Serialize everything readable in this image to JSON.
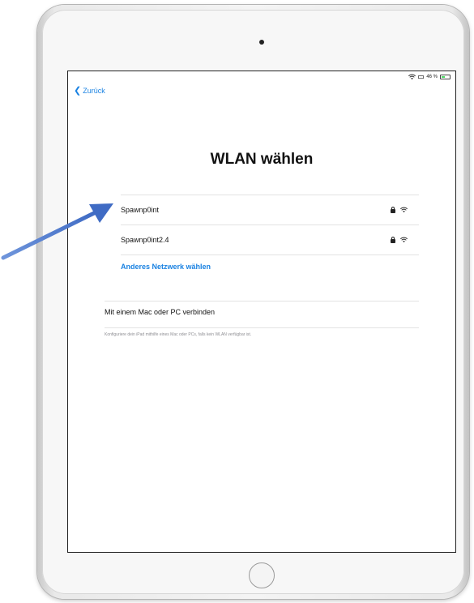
{
  "status_bar": {
    "battery_text": "46 %",
    "battery_level": 0.46,
    "battery_color": "#4cd964"
  },
  "nav": {
    "back_label": "Zurück",
    "accent_color": "#1a82e2"
  },
  "page": {
    "title": "WLAN wählen"
  },
  "networks": [
    {
      "name": "Spawnp0int",
      "secured": true,
      "icons": [
        "lock-icon",
        "wifi-icon"
      ]
    },
    {
      "name": "Spawnp0int2.4",
      "secured": true,
      "icons": [
        "lock-icon",
        "wifi-icon"
      ]
    }
  ],
  "other_network_label": "Anderes Netzwerk wählen",
  "mac_pc": {
    "label": "Mit einem Mac oder PC verbinden",
    "description": "Konfiguriere dein iPad mithilfe eines Mac oder PCs, falls kein WLAN verfügbar ist."
  },
  "annotation": {
    "arrow_color": "#4a76c9"
  }
}
